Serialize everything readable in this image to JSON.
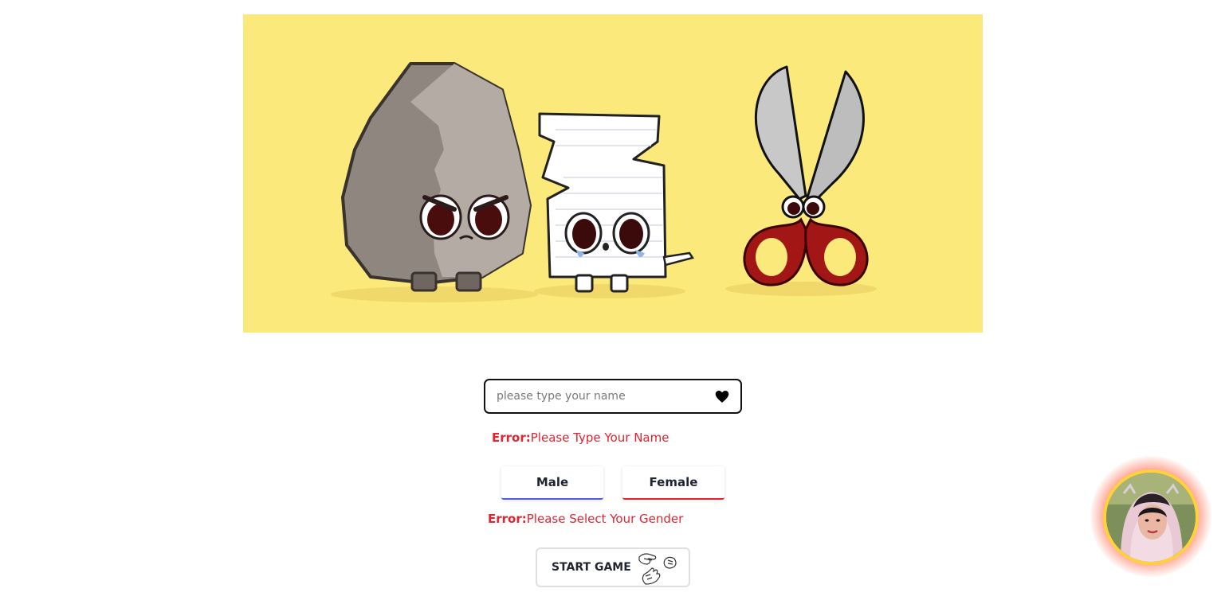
{
  "hero": {
    "icons": [
      "rock-character-icon",
      "paper-character-icon",
      "scissors-character-icon"
    ]
  },
  "name_field": {
    "placeholder": "please type your name",
    "value": "",
    "icon": "heart-icon"
  },
  "errors": {
    "name_prefix": "Error:",
    "name_message": "Please Type Your Name",
    "gender_prefix": "Error:",
    "gender_message": "Please Select Your Gender"
  },
  "gender": {
    "male_label": "Male",
    "female_label": "Female",
    "male_accent": "#4f5ae6",
    "female_accent": "#e22431"
  },
  "start_button": {
    "label": "START GAME",
    "icons": [
      "scissors-hand-icon",
      "rock-hand-icon",
      "paper-hand-icon"
    ]
  },
  "avatar": {
    "icon": "profile-avatar",
    "ring_color": "#ffd23a",
    "glow_color": "#ff5028"
  },
  "colors": {
    "hero_background": "#fbe97c",
    "error": "#e22431"
  }
}
